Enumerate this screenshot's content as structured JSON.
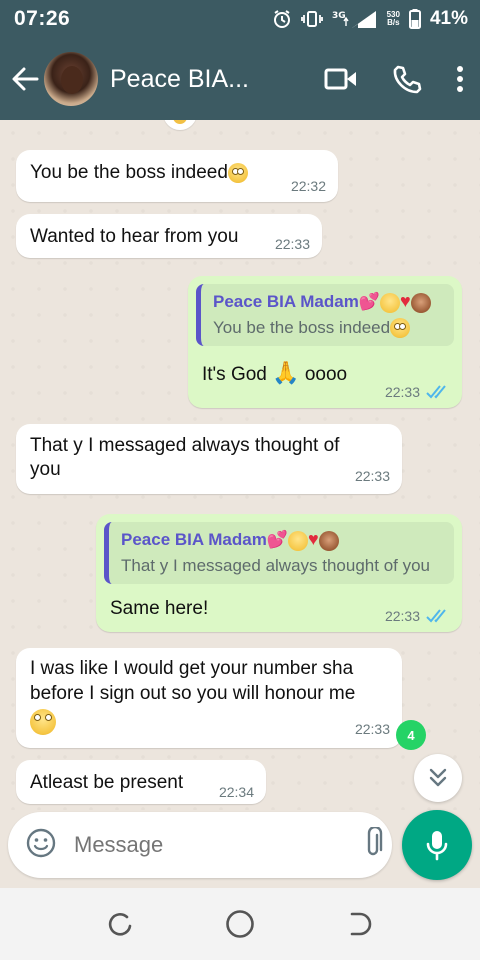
{
  "status_bar": {
    "time": "07:26",
    "network": "3G",
    "net_speed_value": "530",
    "net_speed_unit": "B/s",
    "battery": "41%"
  },
  "header": {
    "contact_name": "Peace BIA...",
    "background_color": "#3c5a62"
  },
  "messages": [
    {
      "direction": "in",
      "text": "You be the boss indeed",
      "emoji": "rolling-eyes",
      "time": "22:32"
    },
    {
      "direction": "in",
      "text": "Wanted to hear from you",
      "time": "22:33"
    },
    {
      "direction": "out",
      "quote_name": "Peace BIA Madam",
      "quote_text": "You be the boss indeed",
      "text_before": "It's God",
      "text_after": "oooo",
      "time": "22:33",
      "status": "read"
    },
    {
      "direction": "in",
      "text_line1": "That y I messaged always thought of",
      "text_line2": "you",
      "time": "22:33"
    },
    {
      "direction": "out",
      "quote_name": "Peace BIA Madam",
      "quote_text": "That y I messaged always thought of you",
      "text": "Same here!",
      "time": "22:33",
      "status": "read"
    },
    {
      "direction": "in",
      "text_line1": "I was like I would get your number sha",
      "text_line2": "before I sign out so you will honour me",
      "time": "22:33"
    },
    {
      "direction": "in",
      "text": "Atleast be present",
      "time": "22:34"
    }
  ],
  "unread_count": "4",
  "compose": {
    "placeholder": "Message"
  },
  "colors": {
    "incoming_bubble": "#ffffff",
    "outgoing_bubble": "#dcf8c6",
    "quote_accent": "#5b55c9",
    "read_ticks": "#4fb6ec",
    "mic_button": "#00a884",
    "unread_badge": "#25d366"
  }
}
